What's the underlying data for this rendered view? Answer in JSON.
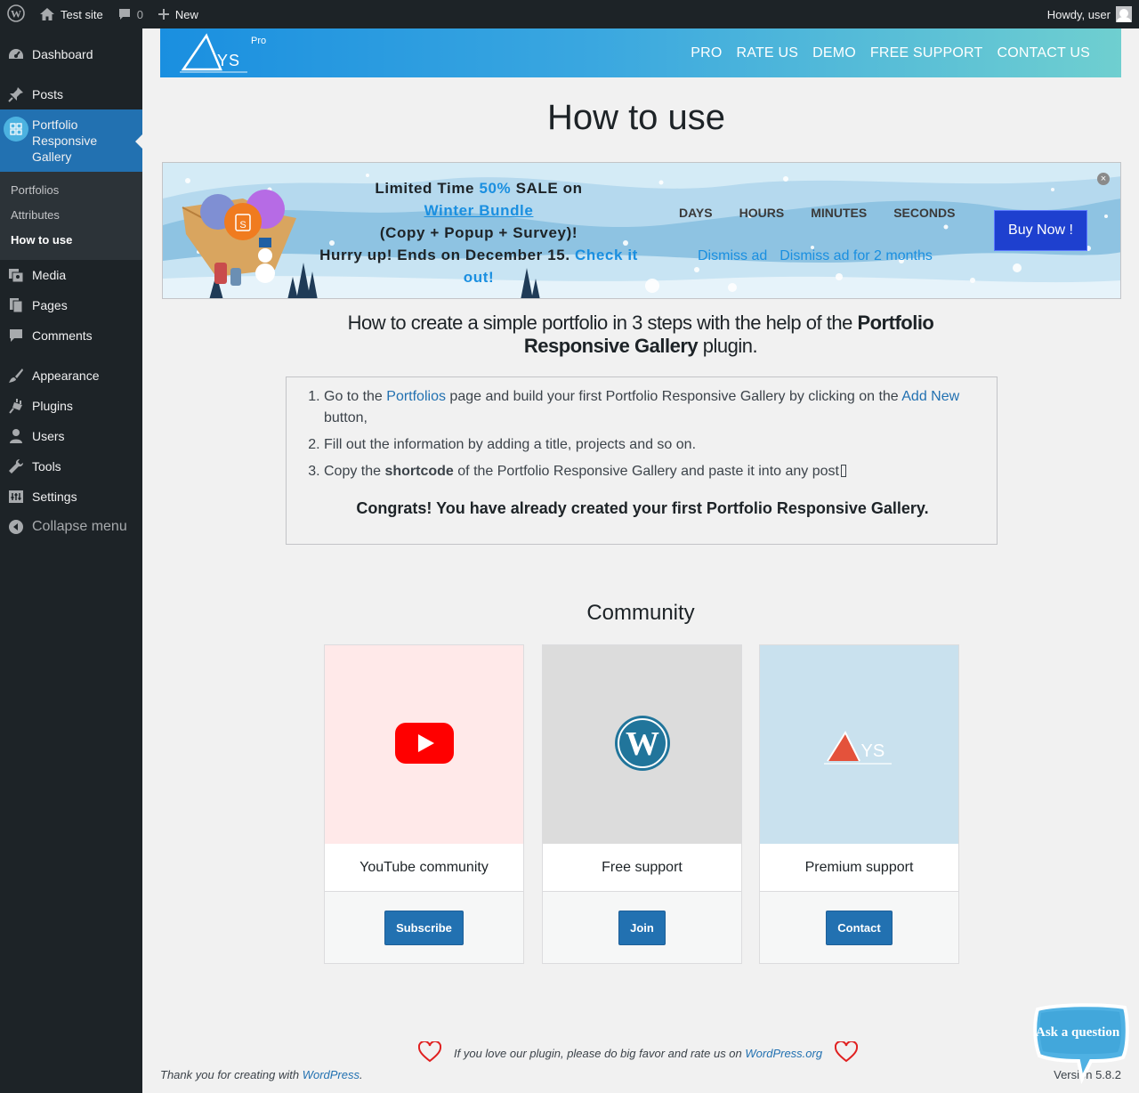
{
  "adminbar": {
    "site_name": "Test site",
    "comments_count": "0",
    "new_label": "New",
    "howdy": "Howdy, user"
  },
  "sidebar": {
    "items": [
      {
        "label": "Dashboard",
        "icon": "dashboard-icon"
      },
      {
        "label": "Posts",
        "icon": "pin-icon"
      },
      {
        "label": "Portfolio Responsive Gallery",
        "icon": "gallery-icon"
      },
      {
        "label": "Media",
        "icon": "media-icon"
      },
      {
        "label": "Pages",
        "icon": "pages-icon"
      },
      {
        "label": "Comments",
        "icon": "comments-icon"
      },
      {
        "label": "Appearance",
        "icon": "brush-icon"
      },
      {
        "label": "Plugins",
        "icon": "plugin-icon"
      },
      {
        "label": "Users",
        "icon": "user-icon"
      },
      {
        "label": "Tools",
        "icon": "wrench-icon"
      },
      {
        "label": "Settings",
        "icon": "settings-icon"
      }
    ],
    "submenu": [
      "Portfolios",
      "Attributes",
      "How to use"
    ],
    "collapse": "Collapse menu"
  },
  "header": {
    "logo_text": "YS",
    "logo_badge": "Pro",
    "nav": [
      "PRO",
      "RATE US",
      "DEMO",
      "FREE SUPPORT",
      "CONTACT US"
    ]
  },
  "page_title": "How to use",
  "banner": {
    "line1_a": "Limited Time ",
    "line1_hl": "50%",
    "line1_b": " SALE on",
    "link": "Winter Bundle",
    "line3": "(Copy + Popup + Survey)!",
    "line4": "Hurry up! Ends on December 15. ",
    "check": "Check it out!",
    "countdown": [
      "DAYS",
      "HOURS",
      "MINUTES",
      "SECONDS"
    ],
    "dismiss": "Dismiss ad",
    "dismiss_2m": "Dismiss ad for 2 months",
    "buy": "Buy Now !",
    "close": "×"
  },
  "intro": {
    "a": "How to create a simple portfolio in 3 steps with the help of the ",
    "bold": "Portfolio Responsive Gallery",
    "b": " plugin."
  },
  "steps": {
    "s1_a": "Go to the ",
    "s1_link1": "Portfolios",
    "s1_b": " page and build your first Portfolio Responsive Gallery by clicking on the ",
    "s1_link2": "Add New",
    "s1_c": " button,",
    "s2": "Fill out the information by adding a title, projects and so on.",
    "s3_a": "Copy the ",
    "s3_bold": "shortcode",
    "s3_b": " of the Portfolio Responsive Gallery and paste it into any post",
    "congrats": "Congrats! You have already created your first Portfolio Responsive Gallery."
  },
  "community": {
    "title": "Community",
    "cards": [
      {
        "name": "YouTube community",
        "button": "Subscribe",
        "bg": "#ffe9e9"
      },
      {
        "name": "Free support",
        "button": "Join",
        "bg": "#dcdcdc"
      },
      {
        "name": "Premium support",
        "button": "Contact",
        "bg": "#c9e1ee"
      }
    ]
  },
  "rate": {
    "text": "If you love our plugin, please do big favor and rate us on ",
    "link": "WordPress.org"
  },
  "footer": {
    "left": "Thank you for creating with ",
    "left_link": "WordPress",
    "left_end": ".",
    "version": "Version 5.8.2"
  },
  "ask": "Ask a question",
  "colors": {
    "admin_dark": "#1d2327",
    "wp_blue": "#2271b1",
    "ays_blue": "#1a8fe0",
    "buy_blue": "#1e40cf"
  }
}
